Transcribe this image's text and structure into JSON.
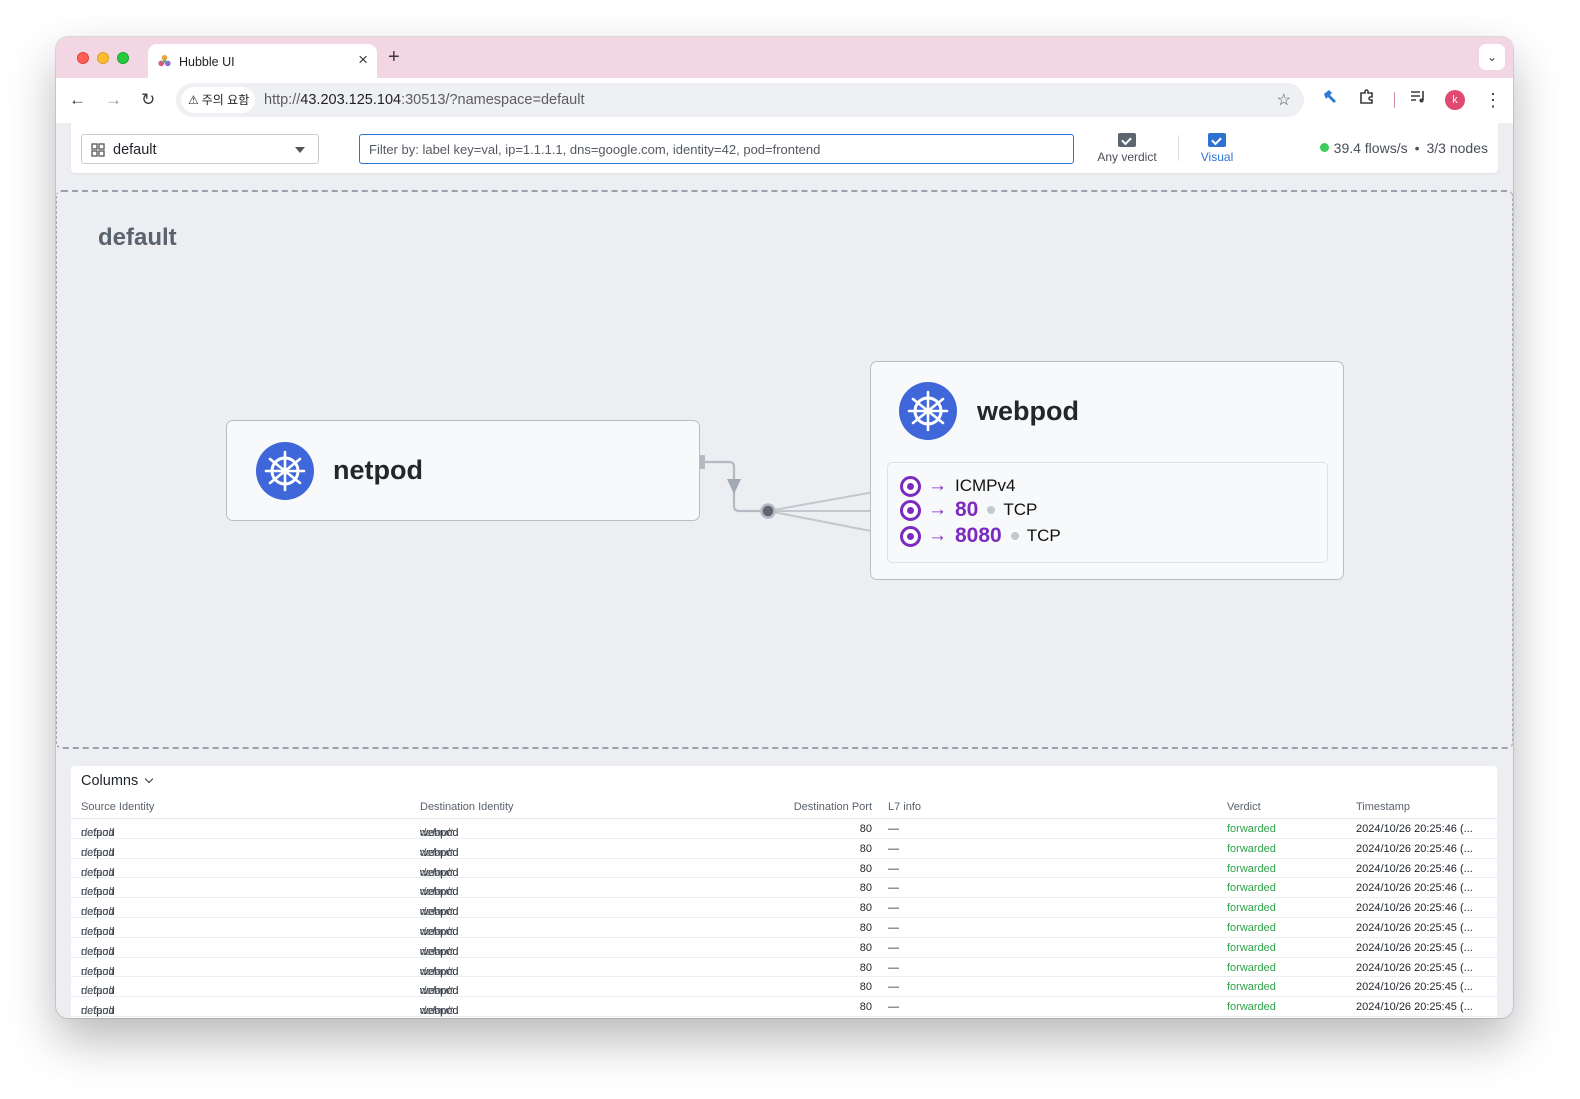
{
  "browser": {
    "tab_title": "Hubble UI",
    "tab_close": "×",
    "new_tab": "+",
    "tab_menu": "⌄",
    "nav_back": "←",
    "nav_forward": "→",
    "nav_reload": "↻",
    "security_chip": "주의 요함",
    "url_scheme": "http://",
    "url_host": "43.203.125.104",
    "url_rest": ":30513/?namespace=default",
    "avatar_letter": "k",
    "star": "☆"
  },
  "header": {
    "namespace": "default",
    "filter_placeholder": "Filter by: label key=val, ip=1.1.1.1, dns=google.com, identity=42, pod=frontend",
    "verdict_button": "Any verdict",
    "visual_button": "Visual",
    "flows_rate": "39.4 flows/s",
    "stats_separator": "•",
    "nodes": "3/3 nodes",
    "status_color": "#3dcc5a"
  },
  "map": {
    "namespace_title": "default",
    "services": [
      {
        "name": "netpod",
        "icon": "kubernetes-icon"
      },
      {
        "name": "webpod",
        "icon": "kubernetes-icon"
      }
    ],
    "webpod_ports": [
      {
        "protocol_only": "ICMPv4"
      },
      {
        "port": "80",
        "protocol": "TCP"
      },
      {
        "port": "8080",
        "protocol": "TCP"
      }
    ],
    "accent_color": "#7b2bbf"
  },
  "flows": {
    "columns_label": "Columns",
    "headers": {
      "source": "Source Identity",
      "destination": "Destination Identity",
      "port": "Destination Port",
      "l7": "L7 info",
      "verdict": "Verdict",
      "timestamp": "Timestamp"
    },
    "rows": [
      {
        "src": "netpod",
        "src_ns": "default",
        "dst": "webpod",
        "dst_ns": "default",
        "port": "80",
        "l7": "—",
        "verdict": "forwarded",
        "ts": "2024/10/26 20:25:46 (..."
      },
      {
        "src": "netpod",
        "src_ns": "default",
        "dst": "webpod",
        "dst_ns": "default",
        "port": "80",
        "l7": "—",
        "verdict": "forwarded",
        "ts": "2024/10/26 20:25:46 (..."
      },
      {
        "src": "netpod",
        "src_ns": "default",
        "dst": "webpod",
        "dst_ns": "default",
        "port": "80",
        "l7": "—",
        "verdict": "forwarded",
        "ts": "2024/10/26 20:25:46 (..."
      },
      {
        "src": "netpod",
        "src_ns": "default",
        "dst": "webpod",
        "dst_ns": "default",
        "port": "80",
        "l7": "—",
        "verdict": "forwarded",
        "ts": "2024/10/26 20:25:46 (..."
      },
      {
        "src": "netpod",
        "src_ns": "default",
        "dst": "webpod",
        "dst_ns": "default",
        "port": "80",
        "l7": "—",
        "verdict": "forwarded",
        "ts": "2024/10/26 20:25:46 (..."
      },
      {
        "src": "netpod",
        "src_ns": "default",
        "dst": "webpod",
        "dst_ns": "default",
        "port": "80",
        "l7": "—",
        "verdict": "forwarded",
        "ts": "2024/10/26 20:25:45 (..."
      },
      {
        "src": "netpod",
        "src_ns": "default",
        "dst": "webpod",
        "dst_ns": "default",
        "port": "80",
        "l7": "—",
        "verdict": "forwarded",
        "ts": "2024/10/26 20:25:45 (..."
      },
      {
        "src": "netpod",
        "src_ns": "default",
        "dst": "webpod",
        "dst_ns": "default",
        "port": "80",
        "l7": "—",
        "verdict": "forwarded",
        "ts": "2024/10/26 20:25:45 (..."
      },
      {
        "src": "netpod",
        "src_ns": "default",
        "dst": "webpod",
        "dst_ns": "default",
        "port": "80",
        "l7": "—",
        "verdict": "forwarded",
        "ts": "2024/10/26 20:25:45 (..."
      },
      {
        "src": "netpod",
        "src_ns": "default",
        "dst": "webpod",
        "dst_ns": "default",
        "port": "80",
        "l7": "—",
        "verdict": "forwarded",
        "ts": "2024/10/26 20:25:45 (..."
      }
    ],
    "verdict_color": "#2fa24a"
  }
}
